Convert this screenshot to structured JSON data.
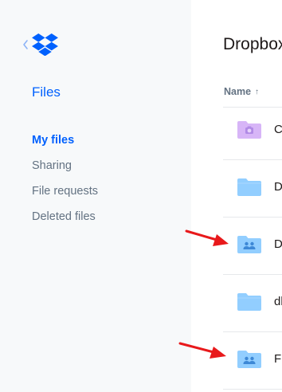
{
  "sidebar": {
    "section_title": "Files",
    "items": [
      {
        "label": "My files",
        "active": true
      },
      {
        "label": "Sharing",
        "active": false
      },
      {
        "label": "File requests",
        "active": false
      },
      {
        "label": "Deleted files",
        "active": false
      }
    ]
  },
  "main": {
    "title": "Dropbox",
    "columns": {
      "name": "Name",
      "sort_arrow": "↑"
    },
    "rows": [
      {
        "name": "C",
        "icon": "camera-uploads-folder-icon"
      },
      {
        "name": "D",
        "icon": "folder-icon"
      },
      {
        "name": "D",
        "icon": "shared-folder-icon"
      },
      {
        "name": "dl",
        "icon": "folder-icon"
      },
      {
        "name": "F",
        "icon": "shared-folder-icon"
      }
    ]
  },
  "colors": {
    "accent": "#0061fe",
    "sidebar_bg": "#f7f9fa",
    "folder_blue": "#92ceff",
    "camera_folder": "#d7b5f7",
    "annotation_arrow": "#e8191b"
  }
}
